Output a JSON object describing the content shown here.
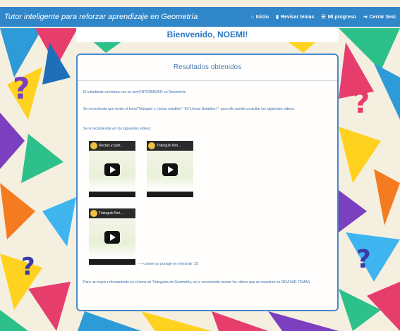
{
  "navbar": {
    "brand": "Tutor inteligente para reforzar aprendizaje en Geometría",
    "items": [
      {
        "label": "Inicio",
        "icon": "home-icon",
        "glyph": "⌂"
      },
      {
        "label": "Revisar temas",
        "icon": "book-icon",
        "glyph": "▮"
      },
      {
        "label": "Mi progreso",
        "icon": "list-icon",
        "glyph": "☰"
      },
      {
        "label": "Cerrar Sesi",
        "icon": "logout-icon",
        "glyph": "⇥"
      }
    ]
  },
  "welcome": "Bienvenido, NOEMI!",
  "panel": {
    "title": "Resultados obtenidos",
    "level_text": "El estudiante comienza con un nivel INTERMEDIO en Geometría.",
    "recommend_text": "Se recomienda que revise el tema\"Triángulo y Líneas notables\": En\"Líneas Notables I\", para ello puede consultar los siguientes videos:",
    "videos_intro": "Se le recomienda ver los siguientes videos:",
    "videos": [
      {
        "title": "Rectas y punt..."
      },
      {
        "title": "Triángulo Not..."
      },
      {
        "title": "Triángulo Not..."
      }
    ],
    "score_text": "---> posee un puntaje en el test de: 15",
    "footer_text": "Para un mayor reforzamiento en el tema de Triángulos de Geometría, se le recomienda revisar los videos que se muestran en REVISAR TEMAS"
  },
  "colors": {
    "navbar": "#2f86c9",
    "accent": "#2f79c5",
    "panel_border": "#4a89c8"
  }
}
